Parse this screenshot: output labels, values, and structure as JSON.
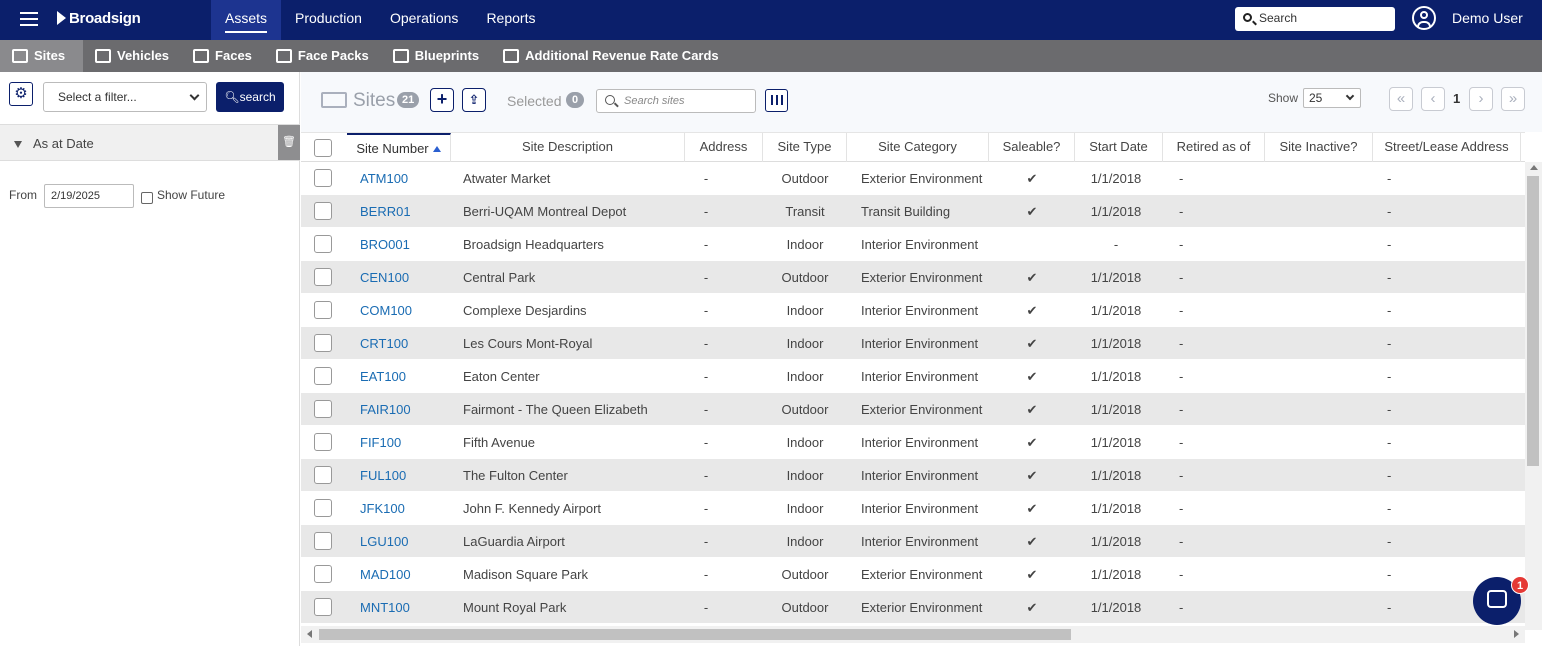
{
  "app": {
    "logo_text": "Broadsign",
    "brand_color": "#0b1f6b",
    "nav": [
      "Assets",
      "Production",
      "Operations",
      "Reports"
    ],
    "active_nav": "Assets",
    "search_placeholder": "Search",
    "user_name": "Demo User"
  },
  "subnav": {
    "items": [
      {
        "label": "Sites",
        "icon": "sites-icon"
      },
      {
        "label": "Vehicles",
        "icon": "bus-icon"
      },
      {
        "label": "Faces",
        "icon": "face-icon"
      },
      {
        "label": "Face Packs",
        "icon": "face-packs-icon"
      },
      {
        "label": "Blueprints",
        "icon": "blueprint-icon"
      },
      {
        "label": "Additional Revenue Rate Cards",
        "icon": "rate-card-icon"
      }
    ],
    "active": "Sites"
  },
  "filters": {
    "select_placeholder": "Select a filter...",
    "search_label": "search",
    "as_at_date_label": "As at Date",
    "from_label": "From",
    "from_value": "2/19/2025",
    "show_future_label": "Show Future",
    "show_future_checked": false
  },
  "toolbar": {
    "title": "Sites",
    "count": "21",
    "selected_label": "Selected",
    "selected_count": "0",
    "search_placeholder": "Search sites",
    "show_label": "Show",
    "page_size": "25",
    "current_page": "1"
  },
  "table": {
    "columns": [
      "Site Number",
      "Site Description",
      "Address",
      "Site Type",
      "Site Category",
      "Saleable?",
      "Start Date",
      "Retired as of",
      "Site Inactive?",
      "Street/Lease Address"
    ],
    "sorted_column": "Site Number",
    "rows": [
      {
        "number": "ATM100",
        "description": "Atwater Market",
        "address": "-",
        "type": "Outdoor",
        "category": "Exterior Environment",
        "saleable": "✔",
        "start": "1/1/2018",
        "retired": "-",
        "inactive": "",
        "street": "-"
      },
      {
        "number": "BERR01",
        "description": "Berri-UQAM Montreal Depot",
        "address": "-",
        "type": "Transit",
        "category": "Transit Building",
        "saleable": "✔",
        "start": "1/1/2018",
        "retired": "-",
        "inactive": "",
        "street": "-"
      },
      {
        "number": "BRO001",
        "description": "Broadsign Headquarters",
        "address": "-",
        "type": "Indoor",
        "category": "Interior Environment",
        "saleable": "",
        "start": "-",
        "retired": "-",
        "inactive": "",
        "street": "-"
      },
      {
        "number": "CEN100",
        "description": "Central Park",
        "address": "-",
        "type": "Outdoor",
        "category": "Exterior Environment",
        "saleable": "✔",
        "start": "1/1/2018",
        "retired": "-",
        "inactive": "",
        "street": "-"
      },
      {
        "number": "COM100",
        "description": "Complexe Desjardins",
        "address": "-",
        "type": "Indoor",
        "category": "Interior Environment",
        "saleable": "✔",
        "start": "1/1/2018",
        "retired": "-",
        "inactive": "",
        "street": "-"
      },
      {
        "number": "CRT100",
        "description": "Les Cours Mont-Royal",
        "address": "-",
        "type": "Indoor",
        "category": "Interior Environment",
        "saleable": "✔",
        "start": "1/1/2018",
        "retired": "-",
        "inactive": "",
        "street": "-"
      },
      {
        "number": "EAT100",
        "description": "Eaton Center",
        "address": "-",
        "type": "Indoor",
        "category": "Interior Environment",
        "saleable": "✔",
        "start": "1/1/2018",
        "retired": "-",
        "inactive": "",
        "street": "-"
      },
      {
        "number": "FAIR100",
        "description": "Fairmont - The Queen Elizabeth",
        "address": "-",
        "type": "Outdoor",
        "category": "Exterior Environment",
        "saleable": "✔",
        "start": "1/1/2018",
        "retired": "-",
        "inactive": "",
        "street": "-"
      },
      {
        "number": "FIF100",
        "description": "Fifth Avenue",
        "address": "-",
        "type": "Indoor",
        "category": "Interior Environment",
        "saleable": "✔",
        "start": "1/1/2018",
        "retired": "-",
        "inactive": "",
        "street": "-"
      },
      {
        "number": "FUL100",
        "description": "The Fulton Center",
        "address": "-",
        "type": "Indoor",
        "category": "Interior Environment",
        "saleable": "✔",
        "start": "1/1/2018",
        "retired": "-",
        "inactive": "",
        "street": "-"
      },
      {
        "number": "JFK100",
        "description": "John F. Kennedy Airport",
        "address": "-",
        "type": "Indoor",
        "category": "Interior Environment",
        "saleable": "✔",
        "start": "1/1/2018",
        "retired": "-",
        "inactive": "",
        "street": "-"
      },
      {
        "number": "LGU100",
        "description": "LaGuardia Airport",
        "address": "-",
        "type": "Indoor",
        "category": "Interior Environment",
        "saleable": "✔",
        "start": "1/1/2018",
        "retired": "-",
        "inactive": "",
        "street": "-"
      },
      {
        "number": "MAD100",
        "description": "Madison Square Park",
        "address": "-",
        "type": "Outdoor",
        "category": "Exterior Environment",
        "saleable": "✔",
        "start": "1/1/2018",
        "retired": "-",
        "inactive": "",
        "street": "-"
      },
      {
        "number": "MNT100",
        "description": "Mount Royal Park",
        "address": "-",
        "type": "Outdoor",
        "category": "Exterior Environment",
        "saleable": "✔",
        "start": "1/1/2018",
        "retired": "-",
        "inactive": "",
        "street": "-"
      }
    ]
  },
  "chat": {
    "badge_count": "1"
  }
}
